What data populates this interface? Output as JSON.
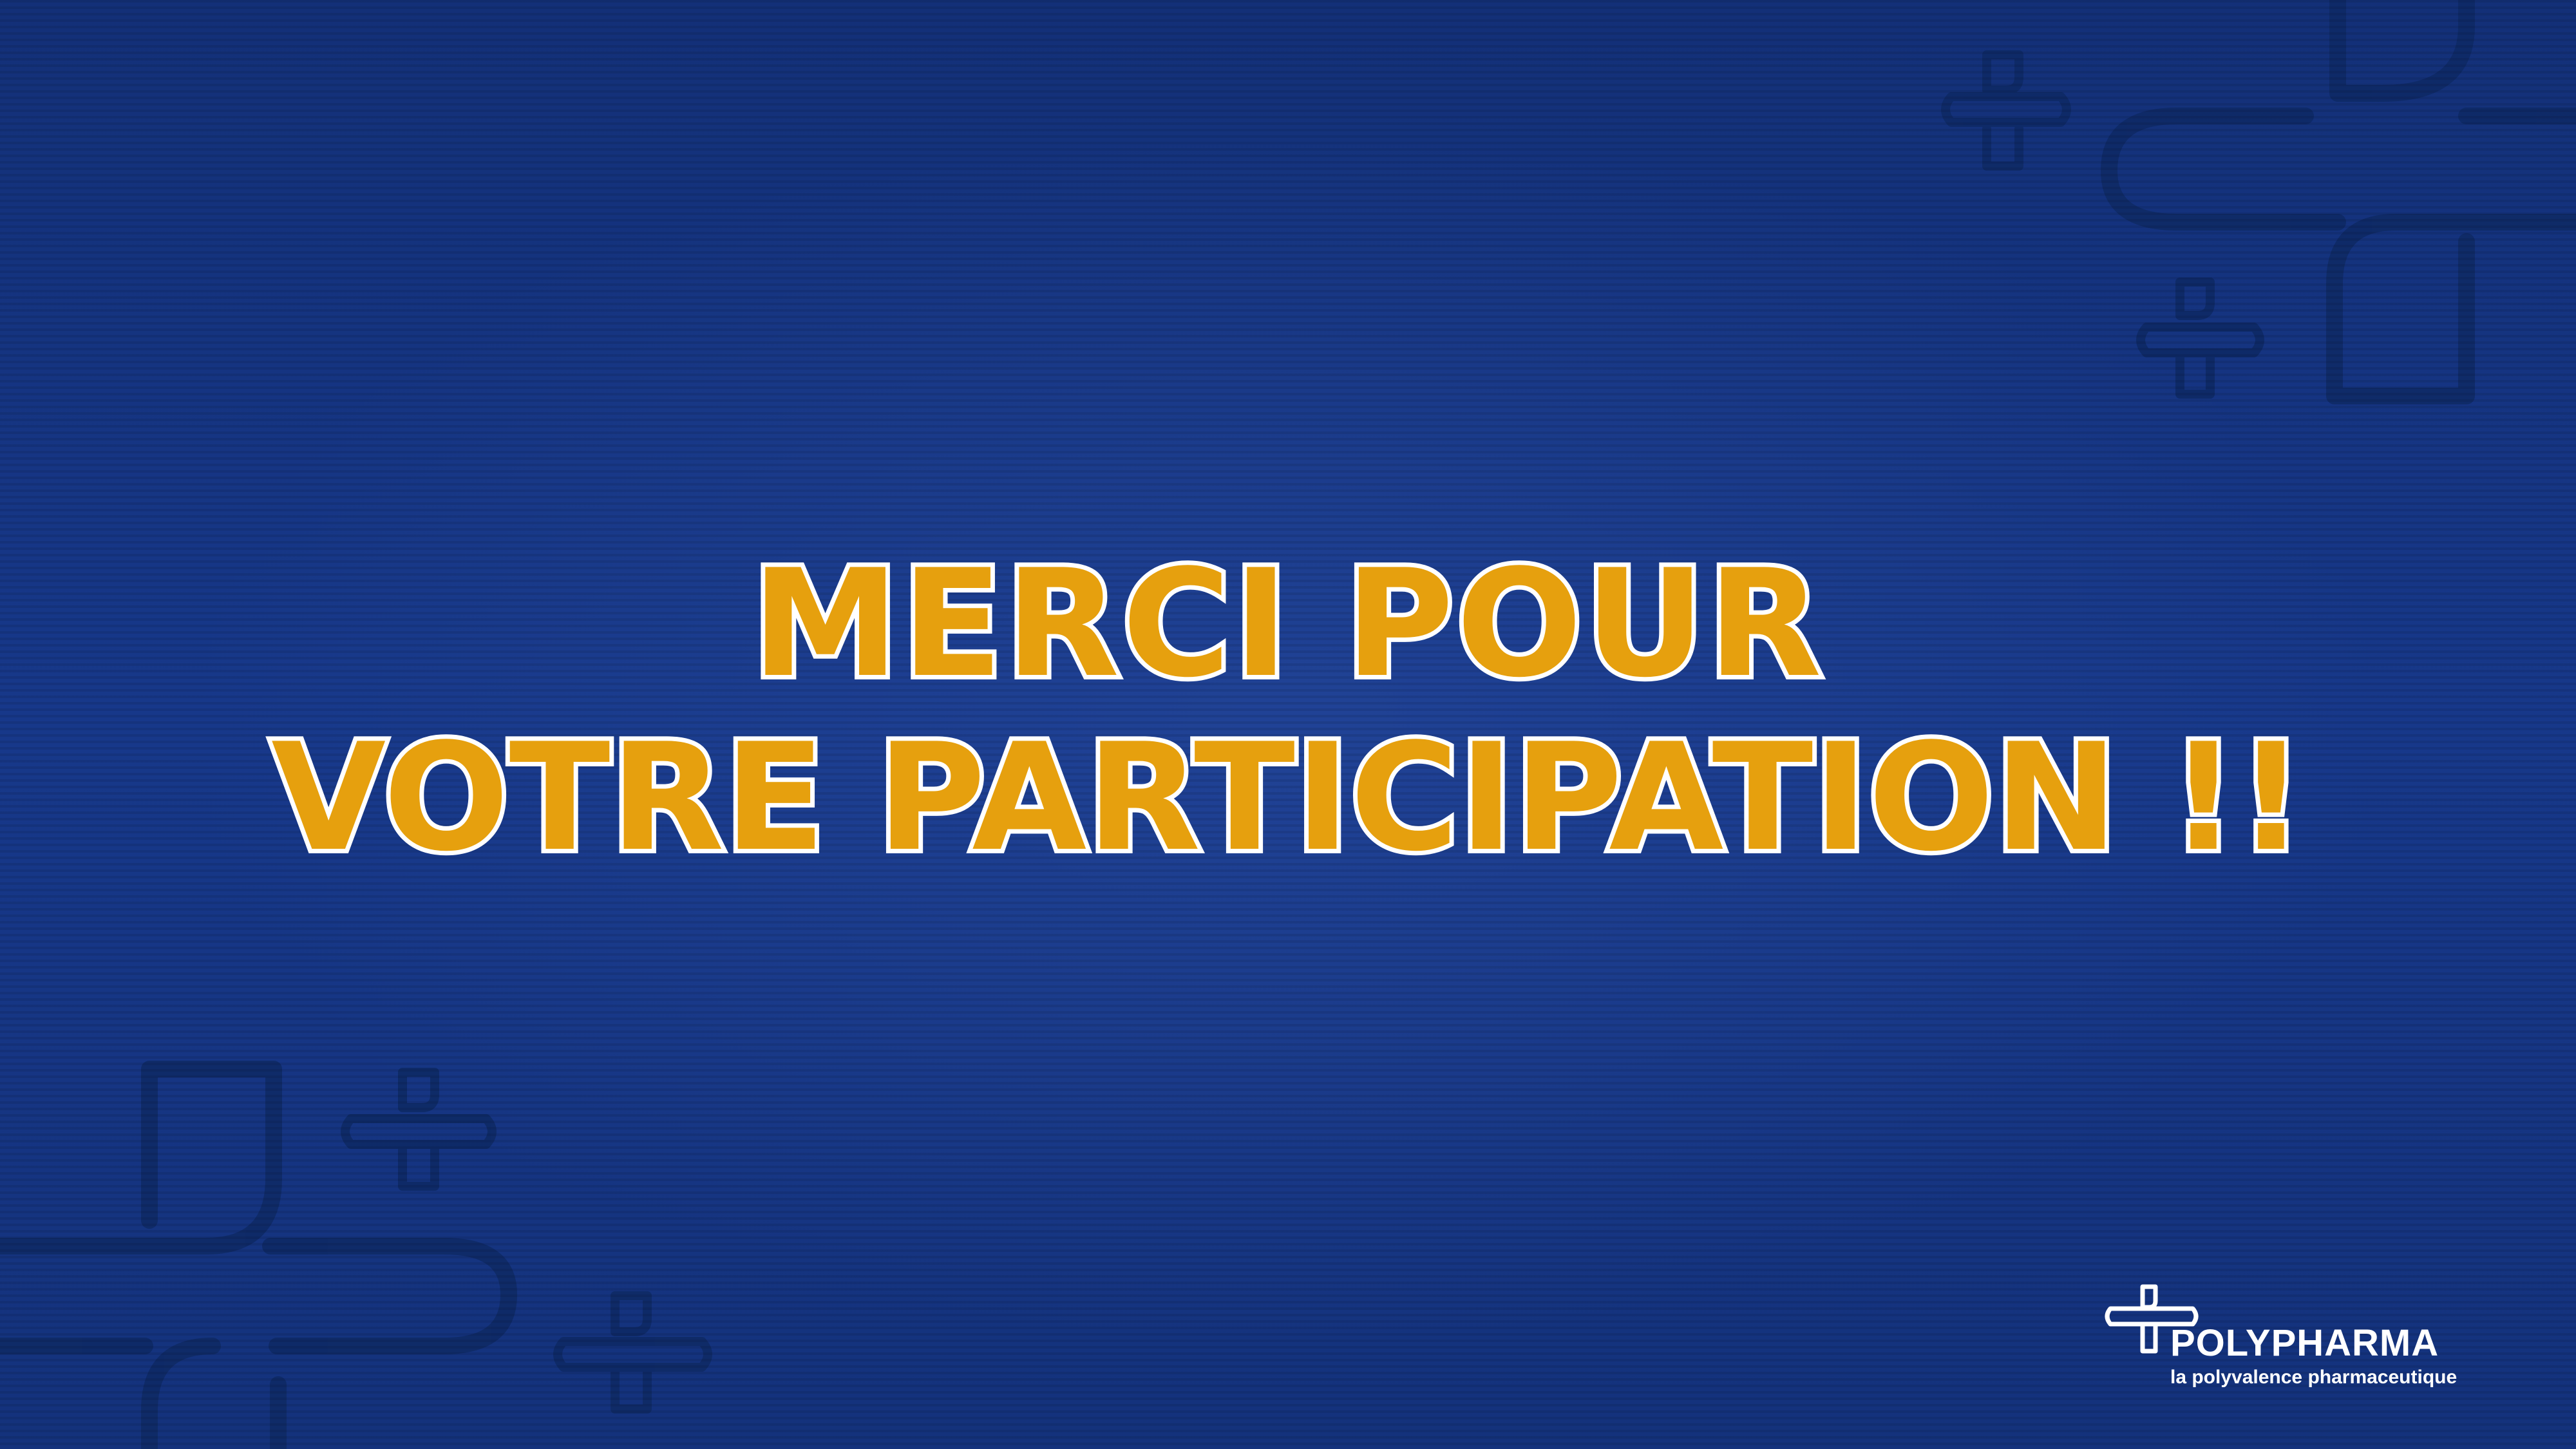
{
  "slide": {
    "headline_line1": "MERCI POUR",
    "headline_line2": "VOTRE PARTICIPATION !!"
  },
  "logo": {
    "brand_name": "POLYPHARMA",
    "tagline": "la polyvalence pharmaceutique"
  },
  "colors": {
    "background": "#17357f",
    "headline_fill": "#e6a00e",
    "headline_outline": "#ffffff",
    "decoration_line": "#0e2a66"
  },
  "icons": [
    "cross-icon",
    "cross-outline-decoration"
  ]
}
